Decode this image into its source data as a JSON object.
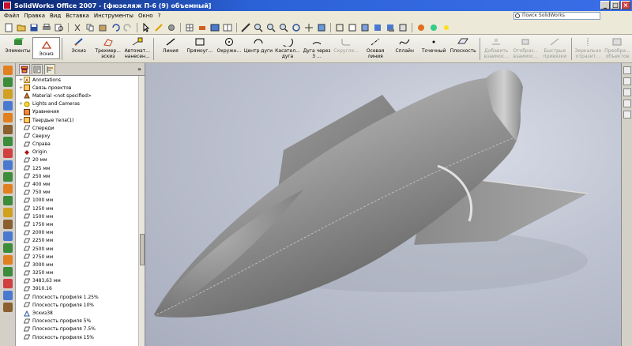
{
  "window": {
    "title": "SolidWorks Office 2007 - [фюзеляж П-6 (9) объемный]",
    "buttons": [
      "_",
      "□",
      "×"
    ]
  },
  "menu": {
    "items": [
      "Файл",
      "Правка",
      "Вид",
      "Вставка",
      "Инструменты",
      "Окно",
      "?"
    ],
    "search_placeholder": "Поиск SolidWorks"
  },
  "command_manager": {
    "items": [
      {
        "label": "Элементы",
        "icon": "features-icon",
        "enabled": true
      },
      {
        "label": "Эскиз",
        "icon": "sketch-icon",
        "enabled": true
      },
      {
        "label": "Эскиз",
        "icon": "sketch-pen-icon",
        "enabled": true
      },
      {
        "label": "Трехмер... эскиз",
        "icon": "3d-sketch-icon",
        "enabled": true
      },
      {
        "label": "Автомат... нанесен...",
        "icon": "auto-dimension-icon",
        "enabled": true
      },
      {
        "label": "Линия",
        "icon": "line-icon",
        "enabled": true
      },
      {
        "label": "Прямоуг...",
        "icon": "rectangle-icon",
        "enabled": true
      },
      {
        "label": "Окружн...",
        "icon": "circle-icon",
        "enabled": true
      },
      {
        "label": "Центр дуги",
        "icon": "center-arc-icon",
        "enabled": true
      },
      {
        "label": "Касател... дуга",
        "icon": "tangent-arc-icon",
        "enabled": true
      },
      {
        "label": "Дуга через 3 ...",
        "icon": "3point-arc-icon",
        "enabled": true
      },
      {
        "label": "Скругле...",
        "icon": "fillet-icon",
        "enabled": false
      },
      {
        "label": "Осевая линия",
        "icon": "centerline-icon",
        "enabled": true
      },
      {
        "label": "Сплайн",
        "icon": "spline-icon",
        "enabled": true
      },
      {
        "label": "Точечный",
        "icon": "point-icon",
        "enabled": true
      },
      {
        "label": "Плоскость",
        "icon": "plane-icon",
        "enabled": true
      },
      {
        "label": "Добавить взаимос...",
        "icon": "add-relation-icon",
        "enabled": false
      },
      {
        "label": "Отобраз... взаимос...",
        "icon": "display-relations-icon",
        "enabled": false
      },
      {
        "label": "Быстрые привязки",
        "icon": "quick-snaps-icon",
        "enabled": false
      },
      {
        "label": "Зеркально отразит...",
        "icon": "mirror-icon",
        "enabled": false
      },
      {
        "label": "Преобра... объектов",
        "icon": "convert-entities-icon",
        "enabled": false
      }
    ]
  },
  "feature_tree": {
    "items": [
      {
        "label": "Annotations",
        "icon": "annotations-icon",
        "expandable": true
      },
      {
        "label": "Связь проектов",
        "icon": "design-binder-icon",
        "expandable": true
      },
      {
        "label": "Material <not specified>",
        "icon": "material-icon",
        "expandable": false
      },
      {
        "label": "Lights and Cameras",
        "icon": "lights-icon",
        "expandable": true
      },
      {
        "label": "Уравнения",
        "icon": "equations-icon",
        "expandable": false
      },
      {
        "label": "Твердые тела(1)",
        "icon": "solid-bodies-icon",
        "expandable": true
      },
      {
        "label": "Спереди",
        "icon": "plane-icon",
        "expandable": false
      },
      {
        "label": "Сверху",
        "icon": "plane-icon",
        "expandable": false
      },
      {
        "label": "Справа",
        "icon": "plane-icon",
        "expandable": false
      },
      {
        "label": "Origin",
        "icon": "origin-icon",
        "expandable": false
      },
      {
        "label": "20 мм",
        "icon": "plane-icon",
        "expandable": false
      },
      {
        "label": "125 мм",
        "icon": "plane-icon",
        "expandable": false
      },
      {
        "label": "250 мм",
        "icon": "plane-icon",
        "expandable": false
      },
      {
        "label": "400 мм",
        "icon": "plane-icon",
        "expandable": false
      },
      {
        "label": "750 мм",
        "icon": "plane-icon",
        "expandable": false
      },
      {
        "label": "1000 мм",
        "icon": "plane-icon",
        "expandable": false
      },
      {
        "label": "1250 мм",
        "icon": "plane-icon",
        "expandable": false
      },
      {
        "label": "1500 мм",
        "icon": "plane-icon",
        "expandable": false
      },
      {
        "label": "1750 мм",
        "icon": "plane-icon",
        "expandable": false
      },
      {
        "label": "2000 мм",
        "icon": "plane-icon",
        "expandable": false
      },
      {
        "label": "2250 мм",
        "icon": "plane-icon",
        "expandable": false
      },
      {
        "label": "2500 мм",
        "icon": "plane-icon",
        "expandable": false
      },
      {
        "label": "2750 мм",
        "icon": "plane-icon",
        "expandable": false
      },
      {
        "label": "3000 мм",
        "icon": "plane-icon",
        "expandable": false
      },
      {
        "label": "3250 мм",
        "icon": "plane-icon",
        "expandable": false
      },
      {
        "label": "3483,63 мм",
        "icon": "plane-icon",
        "expandable": false
      },
      {
        "label": "3910.16",
        "icon": "plane-icon",
        "expandable": false
      },
      {
        "label": "Плоскость профиля 1.25%",
        "icon": "plane-icon",
        "expandable": false
      },
      {
        "label": "Плоскость профиля 10%",
        "icon": "plane-icon",
        "expandable": false
      },
      {
        "label": "Эскиз38",
        "icon": "sketch-icon",
        "expandable": false
      },
      {
        "label": "Плоскость профиля 5%",
        "icon": "plane-icon",
        "expandable": false
      },
      {
        "label": "Плоскость профиля 7.5%",
        "icon": "plane-icon",
        "expandable": false
      },
      {
        "label": "Плоскость профиля 15%",
        "icon": "plane-icon",
        "expandable": false
      }
    ]
  },
  "colors": {
    "titlebar": "#0a246a",
    "viewport_bg": "#bfc4d2",
    "model": "#8c8c8c"
  }
}
